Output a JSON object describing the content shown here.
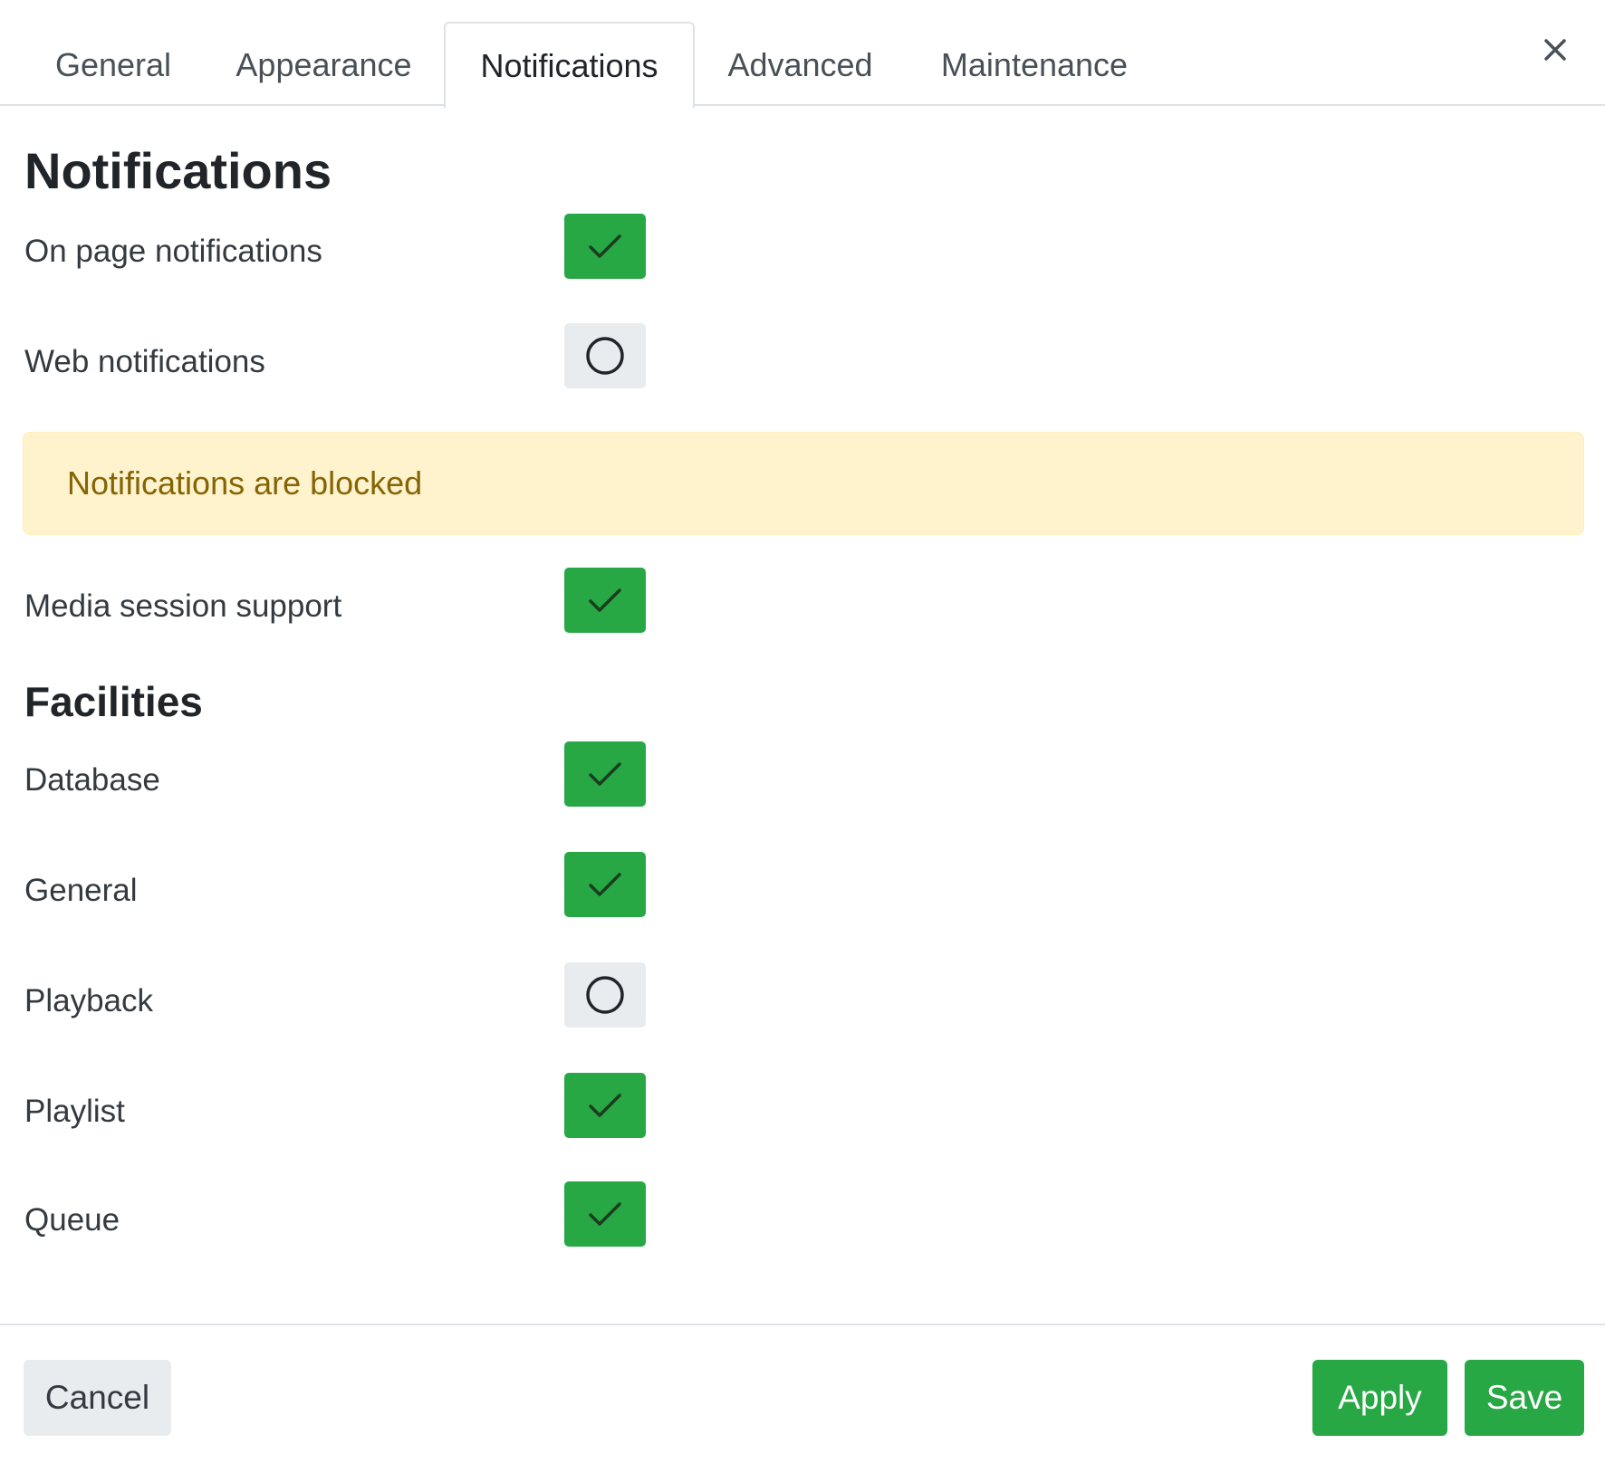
{
  "tabs": [
    {
      "label": "General",
      "active": false
    },
    {
      "label": "Appearance",
      "active": false
    },
    {
      "label": "Notifications",
      "active": true
    },
    {
      "label": "Advanced",
      "active": false
    },
    {
      "label": "Maintenance",
      "active": false
    }
  ],
  "close_icon": "close-icon",
  "notifications": {
    "title": "Notifications",
    "on_page": {
      "label": "On page notifications",
      "checked": true
    },
    "web": {
      "label": "Web notifications",
      "checked": false
    },
    "alert": "Notifications are blocked",
    "media_session": {
      "label": "Media session support",
      "checked": true
    }
  },
  "facilities": {
    "title": "Facilities",
    "items": [
      {
        "label": "Database",
        "checked": true
      },
      {
        "label": "General",
        "checked": true
      },
      {
        "label": "Playback",
        "checked": false
      },
      {
        "label": "Playlist",
        "checked": true
      },
      {
        "label": "Queue",
        "checked": true
      }
    ]
  },
  "footer": {
    "cancel_label": "Cancel",
    "apply_label": "Apply",
    "save_label": "Save"
  },
  "colors": {
    "accent": "#28a745",
    "toggle_off": "#e9ecef",
    "alert_bg": "#fff3cd",
    "alert_text": "#856404"
  }
}
